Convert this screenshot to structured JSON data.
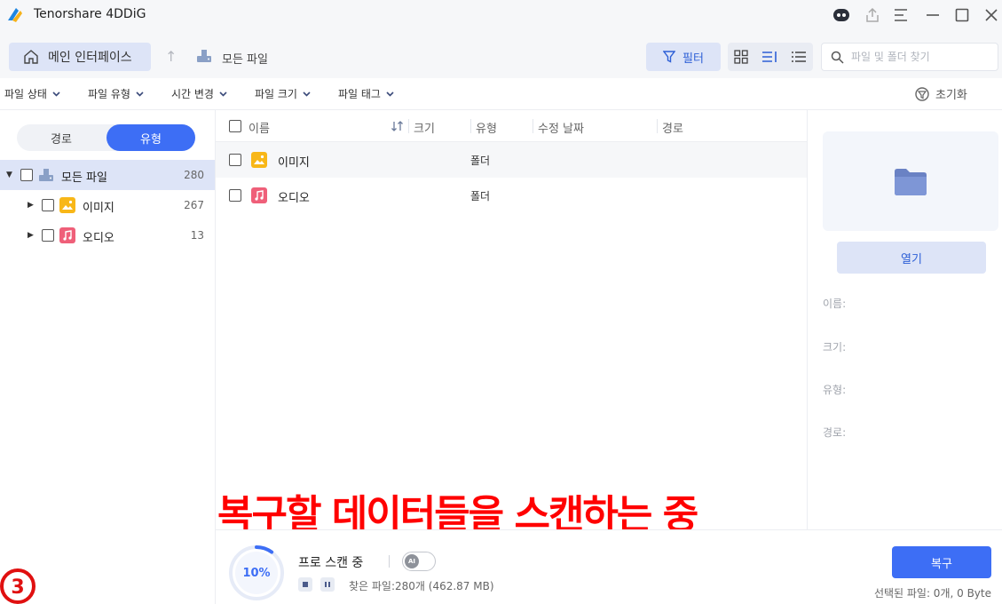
{
  "app": {
    "title": "Tenorshare 4DDiG",
    "accent": "#3d6ef5"
  },
  "titlebar_icons": [
    "robot-icon",
    "share-icon",
    "menu-icon",
    "minimize-icon",
    "maximize-icon",
    "close-icon"
  ],
  "nav": {
    "home_label": "메인 인터페이스",
    "breadcrumb": "모든 파일",
    "filter_label": "필터",
    "search_placeholder": "파일 및 폴더 찾기"
  },
  "filters": {
    "items": [
      "파일 상태",
      "파일 유형",
      "시간 변경",
      "파일 크기",
      "파일 태그"
    ],
    "reset_label": "초기화"
  },
  "left": {
    "tabs": [
      "경로",
      "유형"
    ],
    "active_tab": "유형",
    "tree": [
      {
        "label": "모든 파일",
        "count": "280",
        "icon": "drive-icon"
      },
      {
        "label": "이미지",
        "count": "267",
        "icon": "image-icon"
      },
      {
        "label": "오디오",
        "count": "13",
        "icon": "audio-icon"
      }
    ]
  },
  "table": {
    "columns": [
      "이름",
      "크기",
      "유형",
      "수정 날짜",
      "경로"
    ],
    "rows": [
      {
        "name": "이미지",
        "type": "폴더",
        "icon": "image-icon"
      },
      {
        "name": "오디오",
        "type": "폴더",
        "icon": "audio-icon"
      }
    ]
  },
  "right": {
    "open_label": "열기",
    "props": [
      "이름:",
      "크기:",
      "유형:",
      "경로:"
    ]
  },
  "overlay": "복구할 데이터들을 스캔하는 중",
  "scan": {
    "progress_percent": 10,
    "progress_label": "10%",
    "title": "프로 스캔 중",
    "ai_label": "AI",
    "found": "찾은 파일:280개 (462.87 MB)"
  },
  "bottom": {
    "recover_label": "복구",
    "selected_info": "선택된 파일: 0개, 0 Byte"
  },
  "step_marker": "3"
}
